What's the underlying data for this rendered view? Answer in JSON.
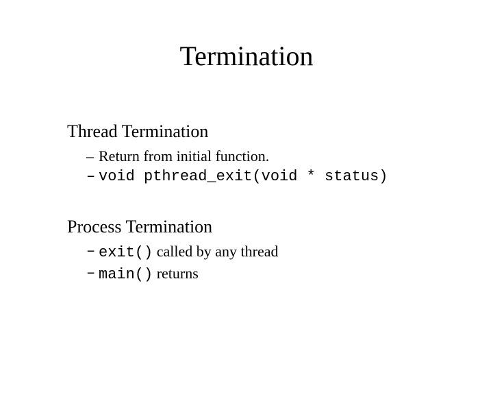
{
  "title": "Termination",
  "section1": {
    "heading": "Thread Termination",
    "bullets": {
      "b1": "Return from initial function.",
      "b2_code": "void pthread_exit(void * status)"
    }
  },
  "section2": {
    "heading": "Process Termination",
    "bullets": {
      "b1_code": "exit()",
      "b1_rest": " called by any thread",
      "b2_code": "main()",
      "b2_rest": " returns"
    }
  },
  "dash": "–"
}
